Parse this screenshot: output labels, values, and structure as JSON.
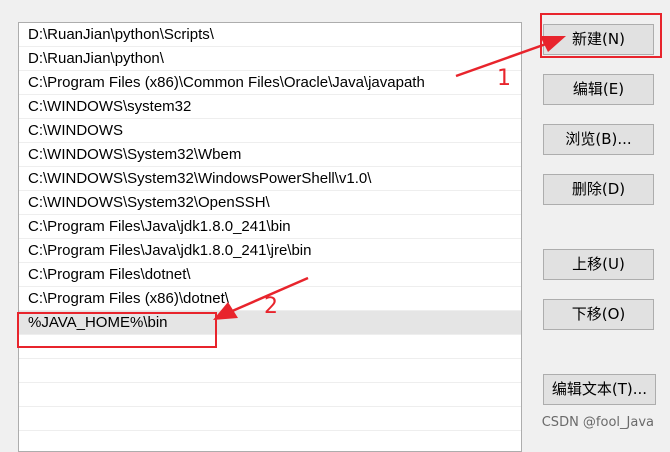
{
  "path_list": {
    "entries": [
      "D:\\RuanJian\\python\\Scripts\\",
      "D:\\RuanJian\\python\\",
      "C:\\Program Files (x86)\\Common Files\\Oracle\\Java\\javapath",
      "C:\\WINDOWS\\system32",
      "C:\\WINDOWS",
      "C:\\WINDOWS\\System32\\Wbem",
      "C:\\WINDOWS\\System32\\WindowsPowerShell\\v1.0\\",
      "C:\\WINDOWS\\System32\\OpenSSH\\",
      "C:\\Program Files\\Java\\jdk1.8.0_241\\bin",
      "C:\\Program Files\\Java\\jdk1.8.0_241\\jre\\bin",
      "C:\\Program Files\\dotnet\\",
      "C:\\Program Files (x86)\\dotnet\\",
      "%JAVA_HOME%\\bin",
      "",
      "",
      "",
      ""
    ],
    "selected_index": 12
  },
  "buttons": {
    "new": "新建(N)",
    "edit": "编辑(E)",
    "browse": "浏览(B)...",
    "delete": "删除(D)",
    "move_up": "上移(U)",
    "move_down": "下移(O)",
    "edit_text": "编辑文本(T)..."
  },
  "annotations": {
    "step1": "1",
    "step2": "2",
    "color": "#e8242c"
  },
  "watermark": "CSDN @fool_Java"
}
